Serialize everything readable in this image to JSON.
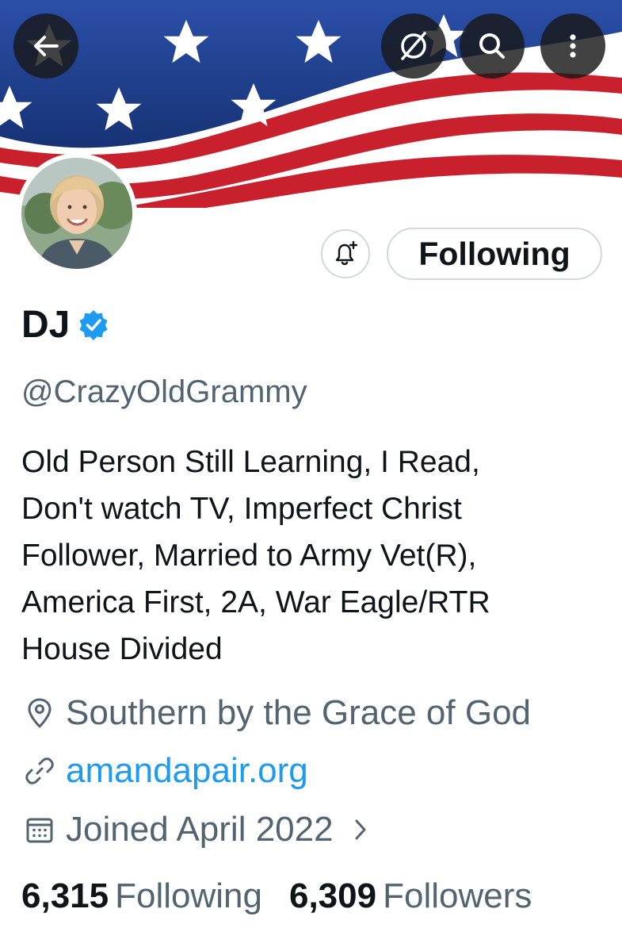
{
  "header": {
    "back_icon": "arrow-left-icon",
    "grok_icon": "grok-icon",
    "search_icon": "search-icon",
    "more_icon": "more-vertical-icon"
  },
  "profile": {
    "display_name": "DJ",
    "verified": true,
    "handle": "@CrazyOldGrammy",
    "bio_lines": [
      "Old Person Still Learning, I Read,",
      "Don't watch TV, Imperfect Christ",
      "Follower, Married to Army Vet(R),",
      "America First, 2A, War Eagle/RTR",
      "House Divided"
    ],
    "location": "Southern by the Grace of God",
    "website": "amandapair.org",
    "joined": "Joined April 2022"
  },
  "actions": {
    "following_label": "Following",
    "notify_icon": "bell-plus-icon"
  },
  "stats": {
    "following_count": "6,315",
    "following_label": "Following",
    "followers_count": "6,309",
    "followers_label": "Followers"
  },
  "colors": {
    "accent": "#1d9bf0",
    "text_primary": "#0f1419",
    "text_secondary": "#536471",
    "border": "#cfd9de",
    "flag_blue": "#1f3d8a",
    "flag_red": "#c8202c"
  }
}
